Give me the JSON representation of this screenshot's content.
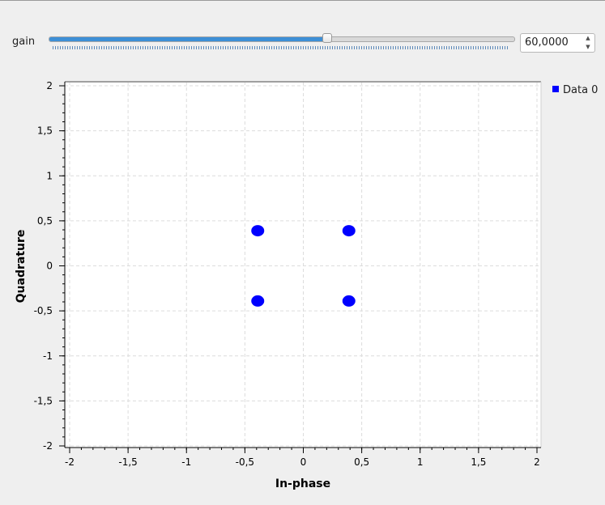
{
  "controls": {
    "gain_label": "gain",
    "gain_value": "60,0000",
    "gain_fraction": 0.6
  },
  "icons": {
    "spin_up": "triangle-up-icon",
    "spin_down": "triangle-down-icon"
  },
  "colors": {
    "slider_fill": "#3d8fd6",
    "series": "#0000ff"
  },
  "chart_data": {
    "type": "scatter",
    "xlabel": "In-phase",
    "ylabel": "Quadrature",
    "xlim": [
      -2,
      2
    ],
    "ylim": [
      -2,
      2
    ],
    "grid": true,
    "legend_position": "top-right",
    "xticks": [
      -2,
      -1.5,
      -1,
      -0.5,
      0,
      0.5,
      1,
      1.5,
      2
    ],
    "xtick_labels": [
      "-2",
      "-1,5",
      "-1",
      "-0,5",
      "0",
      "0,5",
      "1",
      "1,5",
      "2"
    ],
    "yticks": [
      2,
      1.5,
      1,
      0.5,
      0,
      -0.5,
      -1,
      -1.5,
      -2
    ],
    "ytick_labels": [
      "2",
      "1,5",
      "1",
      "0,5",
      "0",
      "-0,5",
      "-1",
      "-1,5",
      "-2"
    ],
    "series": [
      {
        "name": "Data 0",
        "color": "#0000ff",
        "points": [
          [
            -0.39,
            0.39
          ],
          [
            0.39,
            0.39
          ],
          [
            -0.39,
            -0.39
          ],
          [
            0.39,
            -0.39
          ]
        ]
      }
    ]
  }
}
